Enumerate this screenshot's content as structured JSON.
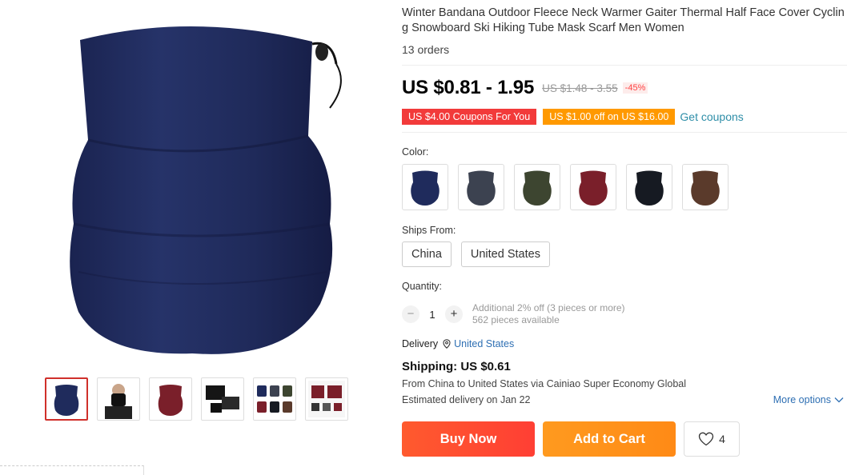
{
  "product": {
    "title": "Winter Bandana Outdoor Fleece Neck Warmer Gaiter Thermal Half Face Cover Cycling Snowboard Ski Hiking Tube Mask Scarf Men Women",
    "orders": "13 orders"
  },
  "price": {
    "current": "US $0.81 - 1.95",
    "original": "US $1.48 - 3.55",
    "discount": "-45%"
  },
  "coupons": {
    "coupon1": "US $4.00 Coupons For You",
    "coupon2": "US $1.00 off on US $16.00",
    "get_link": "Get coupons"
  },
  "color": {
    "label": "Color:",
    "swatches": [
      {
        "name": "navy",
        "color": "#1f2b5c"
      },
      {
        "name": "gray",
        "color": "#3c4250"
      },
      {
        "name": "army-green",
        "color": "#3d4530"
      },
      {
        "name": "wine-red",
        "color": "#7a1f2a"
      },
      {
        "name": "black",
        "color": "#161a22"
      },
      {
        "name": "brown",
        "color": "#5a3a2b"
      }
    ]
  },
  "ships_from": {
    "label": "Ships From:",
    "options": [
      "China",
      "United States"
    ]
  },
  "quantity": {
    "label": "Quantity:",
    "value": "1",
    "minus": "−",
    "plus": "+",
    "note1": "Additional 2% off (3 pieces or more)",
    "note2": "562 pieces available"
  },
  "delivery": {
    "label": "Delivery",
    "location": "United States",
    "icon": "location-pin-icon"
  },
  "shipping": {
    "title": "Shipping: US $0.61",
    "route": "From China to United States via Cainiao Super Economy Global",
    "estimate": "Estimated delivery on Jan 22",
    "more_options": "More options"
  },
  "actions": {
    "buy_now": "Buy Now",
    "add_to_cart": "Add to Cart",
    "wishlist_count": "4"
  },
  "gallery": {
    "main_color": "#1f2b5c",
    "thumb_colors": [
      "#1f2b5c",
      "#222222",
      "#7a1f2a",
      "#151515",
      "#2b3340",
      "#7a1f2a"
    ]
  }
}
